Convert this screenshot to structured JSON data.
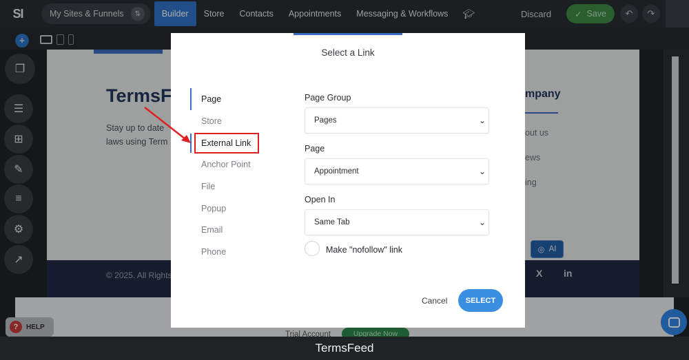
{
  "topbar": {
    "logo": "SI",
    "sites_label": "My Sites & Funnels",
    "sort_icon": "sort-icon",
    "nav": [
      {
        "label": "Builder",
        "active": true
      },
      {
        "label": "Store",
        "active": false
      },
      {
        "label": "Contacts",
        "active": false
      },
      {
        "label": "Appointments",
        "active": false
      },
      {
        "label": "Messaging & Workflows",
        "active": false
      }
    ],
    "discard_label": "Discard",
    "save_label": "Save"
  },
  "canvas": {
    "brand": "TermsF",
    "brand_sub": "Stay up to date laws using Term",
    "company_heading": "mpany",
    "company_links": [
      "out us",
      "ews",
      "ing"
    ],
    "copyright": "© 2025. All Rights",
    "social": [
      "X",
      "in"
    ],
    "ai_label": "AI"
  },
  "help": {
    "label": "HELP"
  },
  "trial": {
    "label": "Trial Account",
    "upgrade": "Upgrade Now"
  },
  "modal": {
    "title": "Select a Link",
    "categories": [
      "Page",
      "Store",
      "External Link",
      "Anchor Point",
      "File",
      "Popup",
      "Email",
      "Phone"
    ],
    "page_group": {
      "label": "Page Group",
      "value": "Pages"
    },
    "page": {
      "label": "Page",
      "value": "Appointment"
    },
    "open_in": {
      "label": "Open In",
      "value": "Same Tab"
    },
    "nofollow_label": "Make \"nofollow\" link",
    "cancel_label": "Cancel",
    "select_label": "SELECT"
  },
  "caption": "TermsFeed",
  "colors": {
    "accent": "#2f73c9",
    "save": "#3e8b46",
    "annotation": "#e02020",
    "select_button": "#3b8fe0"
  }
}
